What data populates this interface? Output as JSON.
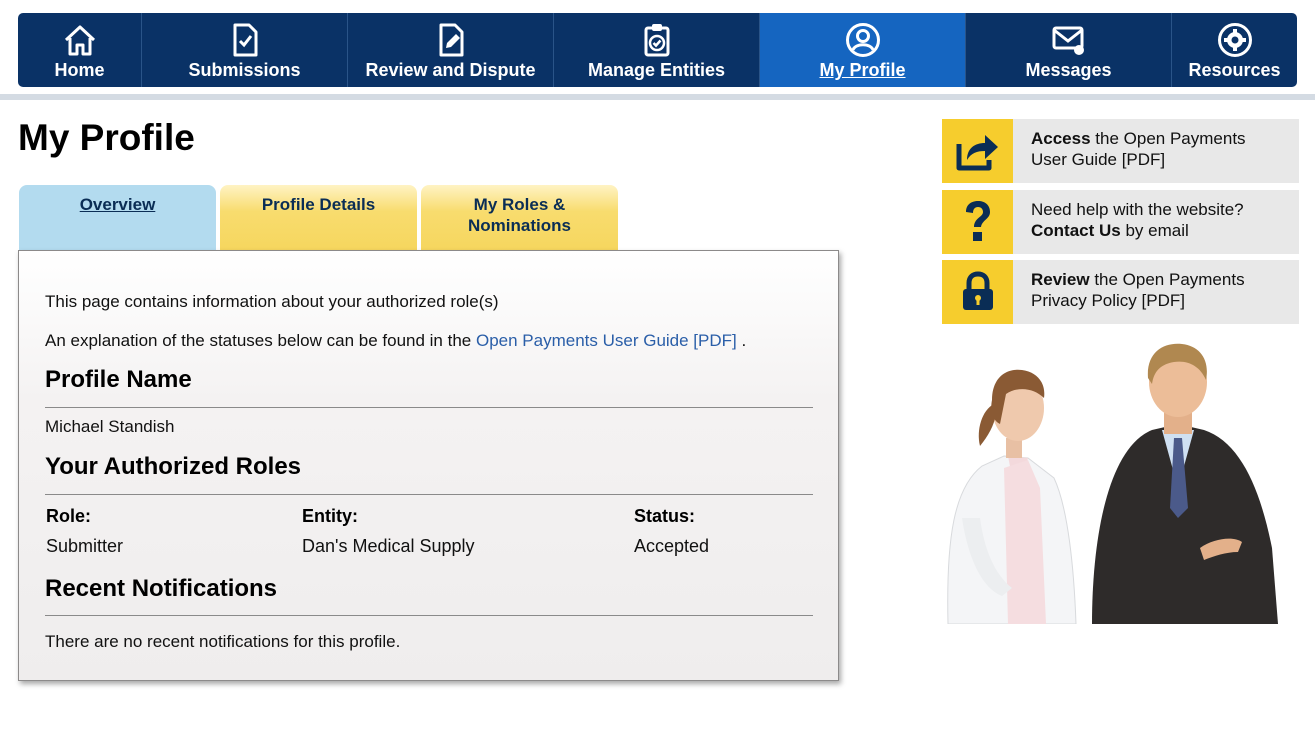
{
  "nav": {
    "items": [
      {
        "label": "Home",
        "icon": "home-icon"
      },
      {
        "label": "Submissions",
        "icon": "document-check-icon"
      },
      {
        "label": "Review and Dispute",
        "icon": "document-edit-icon"
      },
      {
        "label": "Manage Entities",
        "icon": "clipboard-check-icon"
      },
      {
        "label": "My Profile",
        "icon": "user-circle-icon",
        "active": true
      },
      {
        "label": "Messages",
        "icon": "envelope-icon"
      },
      {
        "label": "Resources",
        "icon": "gear-icon"
      }
    ]
  },
  "page": {
    "title": "My Profile"
  },
  "tabs": {
    "overview": "Overview",
    "profile_details": "Profile Details",
    "roles_line1": "My Roles &",
    "roles_line2": "Nominations"
  },
  "panel": {
    "intro": "This page contains information about your authorized role(s)",
    "explanation_prefix": "An explanation of the statuses below can be found in the",
    "explanation_link": "Open Payments User Guide [PDF]",
    "explanation_suffix": ".",
    "profile_name_heading": "Profile Name",
    "profile_name": "Michael Standish",
    "roles_heading": "Your Authorized Roles",
    "roles_columns": {
      "role": "Role:",
      "entity": "Entity:",
      "status": "Status:"
    },
    "roles": [
      {
        "role": "Submitter",
        "entity": "Dan's Medical Supply",
        "status": "Accepted"
      }
    ],
    "notifications_heading": "Recent Notifications",
    "notifications_empty": "There are no recent notifications for this profile."
  },
  "sidebar": {
    "boxes": [
      {
        "icon": "share-arrow-icon",
        "bold": "Access",
        "text1": " the Open Payments",
        "text2": "User Guide [PDF]"
      },
      {
        "icon": "question-mark-icon",
        "line1": "Need help with the website?",
        "bold": "Contact Us",
        "text2": " by email"
      },
      {
        "icon": "lock-icon",
        "bold": "Review",
        "text1": " the Open Payments",
        "text2": "Privacy Policy [PDF]"
      }
    ]
  },
  "colors": {
    "nav_bg": "#0a3266",
    "nav_active": "#1565c0",
    "tab_active": "#b3dbef",
    "tab_inactive": "#f6d65e",
    "sidebar_icon_bg": "#f6cd2d"
  }
}
